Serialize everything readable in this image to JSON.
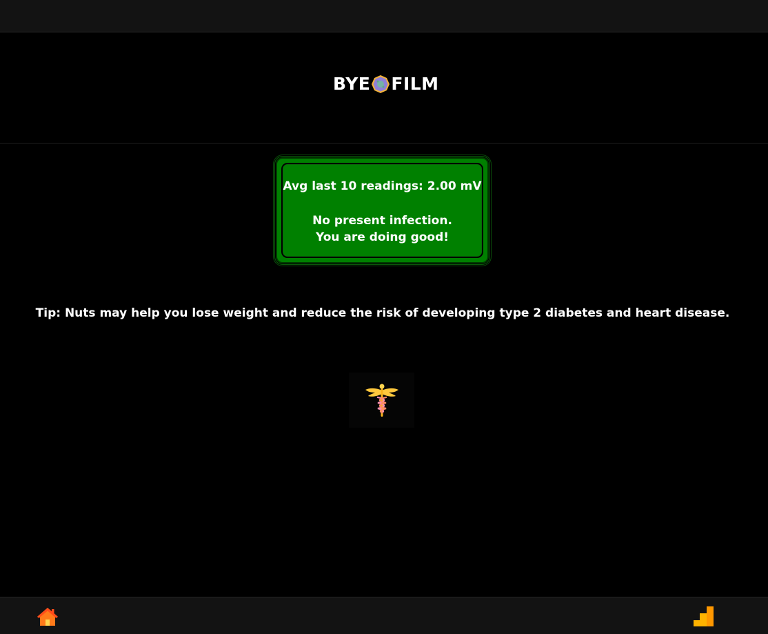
{
  "header": {
    "logo": {
      "text_left": "BYE",
      "text_right": "FILM",
      "icon": "bacteria-icon"
    }
  },
  "status_card": {
    "average_text": "Avg last 10 readings: 2.00 mV",
    "message_line1": "No present infection.",
    "message_line2": "You are doing good!",
    "background_color": "#008000"
  },
  "tip": {
    "text": "Tip: Nuts may help you lose weight and reduce the risk of developing type 2 diabetes and heart disease."
  },
  "medical_icon": "caduceus-icon",
  "bottom_nav": {
    "home_icon": "home-icon",
    "stats_icon": "stats-icon",
    "accent_color": "#ffb300"
  }
}
